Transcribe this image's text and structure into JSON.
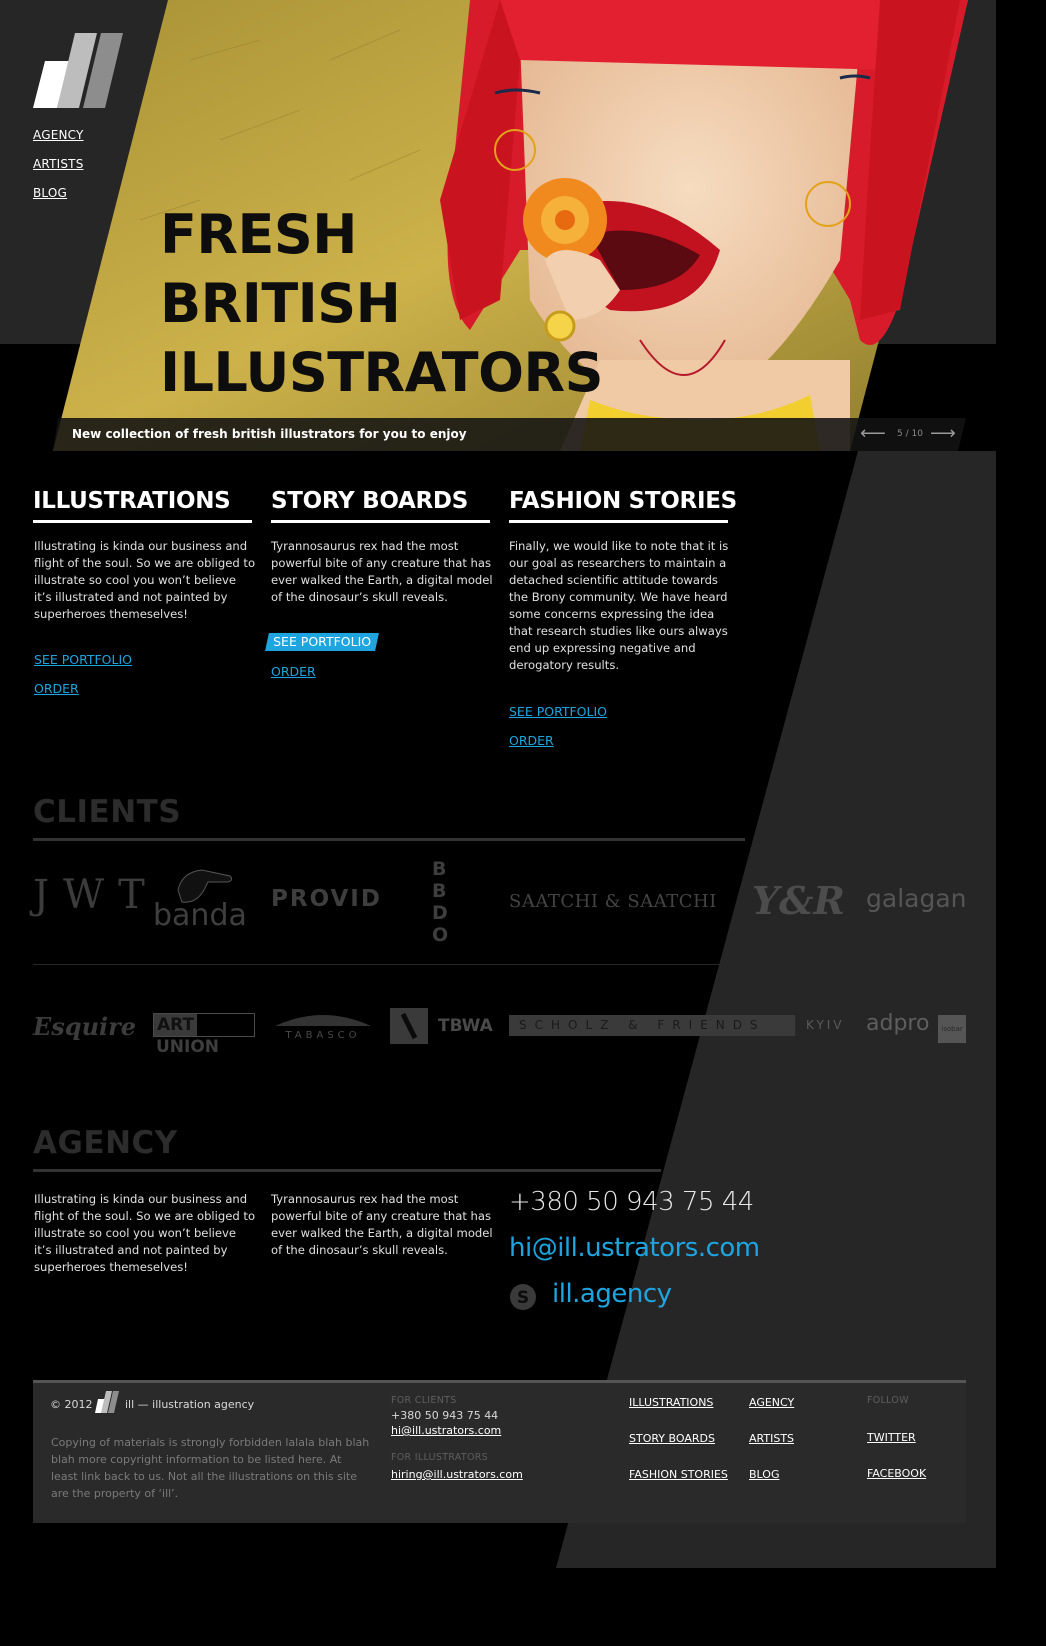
{
  "nav": {
    "items": [
      "AGENCY",
      "ARTISTS",
      "BLOG"
    ]
  },
  "hero": {
    "title_lines": [
      "FRESH",
      "BRITISH",
      "ILLUSTRATORS"
    ],
    "caption": "New collection of fresh british illustrators for you to enjoy",
    "counter": "5 / 10",
    "prev_icon": "arrow-left-icon",
    "next_icon": "arrow-right-icon"
  },
  "services": [
    {
      "title": "ILLUSTRATIONS",
      "text": "Illustrating is kinda our business and flight of the soul. So we are obliged to illustrate so cool you won’t believe it’s illustrated and not painted by superheroes themeselves!",
      "portfolio": "SEE PORTFOLIO",
      "order": "ORDER"
    },
    {
      "title": "STORY BOARDS",
      "text": "Tyrannosaurus rex had the most powerful bite of any creature that has ever walked the Earth, a digital model of the dinosaur’s skull reveals.",
      "portfolio": "SEE PORTFOLIO",
      "order": "ORDER"
    },
    {
      "title": "FASHION STORIES",
      "text": "Finally, we would like to note that it is our goal as researchers to maintain a detached scientific attitude towards the Brony community.  We have heard some concerns expressing the idea that research studies like ours always end up expressing negative and derogatory results.",
      "portfolio": "SEE PORTFOLIO",
      "order": "ORDER"
    }
  ],
  "clients": {
    "title": "CLIENTS",
    "row1": [
      "JWT",
      "banda",
      "PROVID",
      "BBDO",
      "SAATCHI & SAATCHI",
      "Y&R",
      "galagan"
    ],
    "row2": [
      "Esquire",
      "ART",
      "UNION",
      "TABASCO",
      "TBWA",
      "SCHOLZ & FRIENDS",
      "KYIV",
      "adpro",
      "isobar"
    ]
  },
  "agency": {
    "title": "AGENCY",
    "text1": "Illustrating is kinda our business and flight of the soul. So we are obliged to illustrate so cool you won’t believe it’s illustrated and not painted by superheroes themeselves!",
    "text2": "Tyrannosaurus rex had the most powerful bite of any creature that has ever walked the Earth, a digital model of the dinosaur’s skull reveals.",
    "phone": "+380 50 943 75 44",
    "email": "hi@ill.ustrators.com",
    "skype": "ill.agency",
    "skype_icon": "skype-icon"
  },
  "footer": {
    "copyright": "© 2012",
    "brand": "ill — illustration agency",
    "notice": "Copying of materials is strongly forbidden lalala blah blah blah more copyright information to be listed here. At least link back to us. Not all the illustrations on this site are the property of ‘ill’.",
    "for_clients_label": "FOR CLIENTS",
    "clients_phone": "+380 50 943 75 44",
    "clients_email": "hi@ill.ustrators.com",
    "for_illustrators_label": "FOR ILLUSTRATORS",
    "illustrators_email": "hiring@ill.ustrators.com",
    "links_col1": [
      "ILLUSTRATIONS",
      "STORY BOARDS",
      "FASHION STORIES"
    ],
    "links_col2": [
      "AGENCY",
      "ARTISTS",
      "BLOG"
    ],
    "follow_label": "FOLLOW",
    "social": [
      "TWITTER",
      "FACEBOOK"
    ]
  },
  "colors": {
    "accent": "#1ea5e0",
    "panel": "#262626",
    "hero_bg": "#c8a83a",
    "hair": "#e01e2a"
  }
}
